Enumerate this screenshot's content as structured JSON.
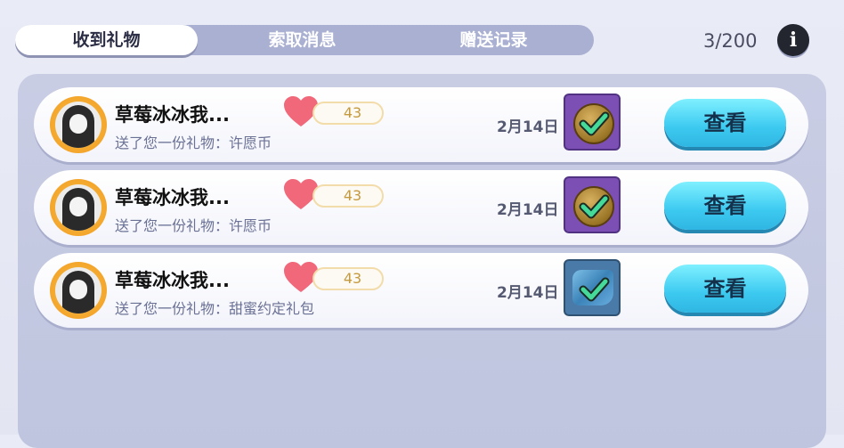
{
  "tabs": [
    {
      "label": "收到礼物",
      "active": true
    },
    {
      "label": "索取消息",
      "active": false
    },
    {
      "label": "赠送记录",
      "active": false
    }
  ],
  "counter": "3/200",
  "info_icon": "info-icon",
  "colors": {
    "accent_button": "#3cc9f0",
    "tab_bar": "#aab0d2",
    "heart": "#f0687a",
    "check": "#45d99a"
  },
  "rows": [
    {
      "name": "草莓冰冰我...",
      "description": "送了您一份礼物：许愿币",
      "score": "43",
      "date": "2月14日",
      "gift_icon": "wish-coin-icon",
      "button": "查看"
    },
    {
      "name": "草莓冰冰我...",
      "description": "送了您一份礼物：许愿币",
      "score": "43",
      "date": "2月14日",
      "gift_icon": "wish-coin-icon",
      "button": "查看"
    },
    {
      "name": "草莓冰冰我...",
      "description": "送了您一份礼物：甜蜜约定礼包",
      "score": "43",
      "date": "2月14日",
      "gift_icon": "sweet-promise-pack-icon",
      "button": "查看"
    }
  ]
}
